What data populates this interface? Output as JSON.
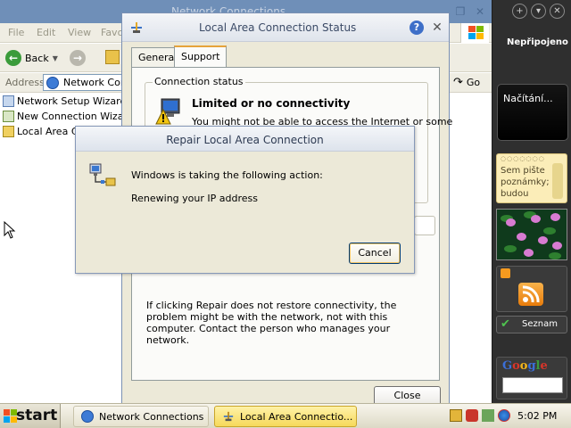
{
  "explorer": {
    "title": "Network Connections",
    "menus": [
      "File",
      "Edit",
      "View",
      "Favo"
    ],
    "back_label": "Back",
    "address_label": "Address",
    "address_value": "Network Conn",
    "go_label": "Go",
    "items": [
      {
        "label": "Network Setup Wizard",
        "icon": "network-wizard-icon"
      },
      {
        "label": "New Connection Wizard",
        "icon": "new-connection-wizard-icon"
      },
      {
        "label": "Local Area Co",
        "icon": "local-area-connection-icon"
      }
    ]
  },
  "status_dialog": {
    "title": "Local Area Connection Status",
    "tabs": [
      "General",
      "Support"
    ],
    "active_tab": "Support",
    "group_label": "Connection status",
    "status_heading": "Limited or no connectivity",
    "status_text": "You might not be able to access the Internet or some",
    "repair_note": "If clicking Repair does not restore connectivity, the problem might be with the network, not with this computer. Contact the person who manages your network.",
    "close_label": "Close",
    "help_label": "?"
  },
  "repair_dialog": {
    "title": "Repair Local Area Connection",
    "message": "Windows is taking the following action:",
    "action": "Renewing your IP address",
    "cancel_label": "Cancel"
  },
  "sidebar": {
    "status": "Nepřipojeno",
    "gadget_loading": "Načítání...",
    "notes_text": "Sem pište poznámky; budou",
    "seznam_label": "Seznam",
    "google_label": "Google"
  },
  "taskbar": {
    "start_label": "start",
    "tasks": [
      {
        "label": "Network Connections",
        "active": false
      },
      {
        "label": "Local Area Connectio...",
        "active": true
      }
    ],
    "clock": "5:02 PM"
  },
  "colors": {
    "taskbar_active": "#f6d95a",
    "sidebar_bg": "#2f2f2f",
    "warning_yellow": "#f2c511",
    "google_blue": "#3b6fd8",
    "google_red": "#d9352a",
    "google_yellow": "#f2b51b",
    "google_green": "#3a9a3a"
  }
}
